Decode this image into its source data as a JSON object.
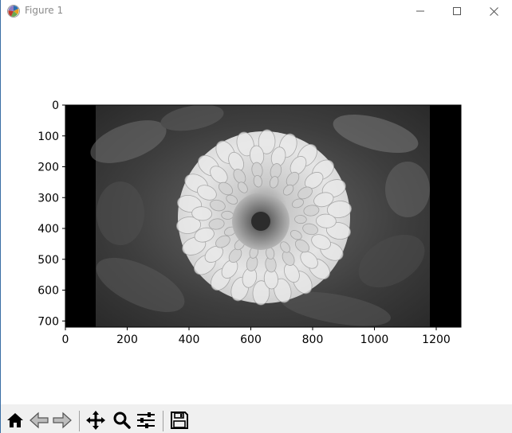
{
  "window": {
    "title": "Figure 1",
    "app_icon": "matplotlib-icon",
    "controls": [
      "minimize-icon",
      "maximize-icon",
      "close-icon"
    ]
  },
  "figure": {
    "image_description": "grayscale photograph of a dahlia flower with black padding bars on left and right",
    "image_content": "grayscale dahlia flower photo",
    "x_ticks": [
      "0",
      "200",
      "400",
      "600",
      "800",
      "1000",
      "1200"
    ],
    "y_ticks": [
      "0",
      "100",
      "200",
      "300",
      "400",
      "500",
      "600",
      "700"
    ],
    "x_tick_values": [
      0,
      200,
      400,
      600,
      800,
      1000,
      1200
    ],
    "y_tick_values": [
      0,
      100,
      200,
      300,
      400,
      500,
      600,
      700
    ],
    "x_range": [
      0,
      1280
    ],
    "y_range": [
      0,
      720
    ]
  },
  "toolbar": {
    "buttons": [
      {
        "name": "home-button",
        "icon": "home-icon"
      },
      {
        "name": "back-button",
        "icon": "back-arrow-icon"
      },
      {
        "name": "forward-button",
        "icon": "forward-arrow-icon"
      },
      {
        "name": "pan-button",
        "icon": "move-icon"
      },
      {
        "name": "zoom-button",
        "icon": "zoom-icon"
      },
      {
        "name": "configure-subplots-button",
        "icon": "sliders-icon"
      },
      {
        "name": "save-button",
        "icon": "save-icon"
      }
    ]
  }
}
